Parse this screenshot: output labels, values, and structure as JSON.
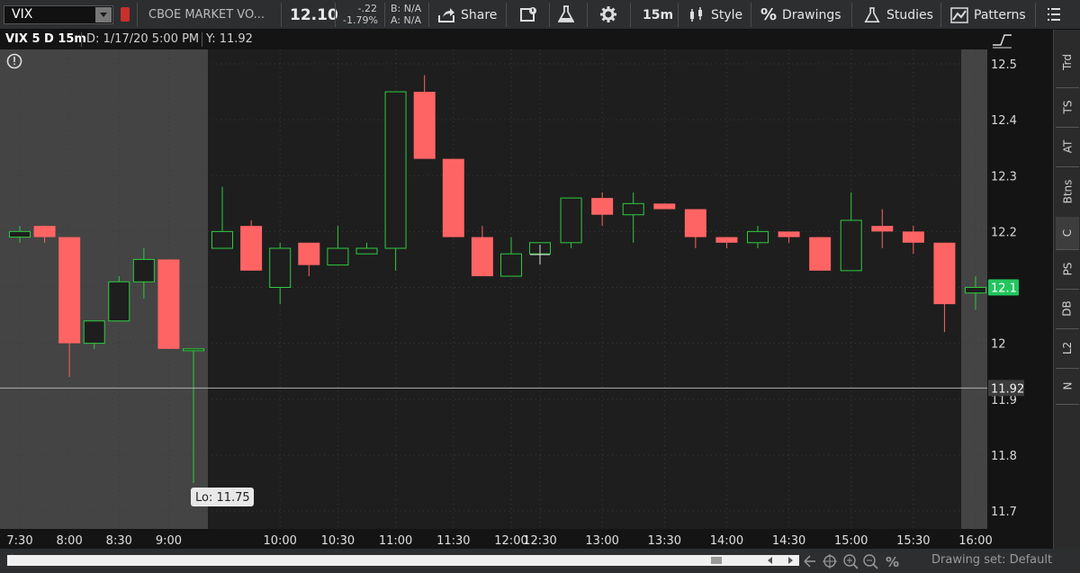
{
  "toolbar": {
    "symbol": "VIX",
    "description": "CBOE MARKET VO...",
    "last": "12.10",
    "net_change": "-.22",
    "pct_change": "-1.79%",
    "bid": "B: N/A",
    "ask": "A: N/A",
    "share": "Share",
    "timeframe": "15m",
    "style": "Style",
    "drawings": "Drawings",
    "studies": "Studies",
    "patterns": "Patterns"
  },
  "header": {
    "title": "VIX 5 D 15m",
    "date": "D: 1/17/20 5:00 PM",
    "y": "Y: 11.92"
  },
  "side_tabs": [
    "Trd",
    "TS",
    "AT",
    "Btns",
    "C",
    "PS",
    "DB",
    "L2",
    "N"
  ],
  "active_side_tab": "C",
  "drawing_set": "Drawing set: Default",
  "colors": {
    "up": "#2ecc40",
    "down": "#ff6464",
    "last_badge": "#22c55e",
    "background": "#1e1e1e",
    "extended_hours": "#444444"
  },
  "chart_data": {
    "type": "candlestick",
    "x_axis": {
      "labels": [
        "7:30",
        "8:00",
        "8:30",
        "9:00",
        "10:00",
        "10:30",
        "11:00",
        "11:30",
        "12:00",
        "12:30",
        "13:00",
        "13:30",
        "14:00",
        "14:30",
        "15:00",
        "15:30",
        "16:00"
      ]
    },
    "y_axis": {
      "ticks": [
        "12.5",
        "12.4",
        "12.3",
        "12.2",
        "12.1",
        "12",
        "11.9",
        "11.8",
        "11.7"
      ],
      "range": [
        11.67,
        12.52
      ]
    },
    "last_price_label": "12.1",
    "crosshair_label": "11.92",
    "crosshair_price": 11.92,
    "low_marker": {
      "label": "Lo: 11.75",
      "time": "9:15"
    },
    "candles": [
      {
        "t": "7:30",
        "o": 12.19,
        "h": 12.21,
        "l": 12.18,
        "c": 12.2
      },
      {
        "t": "7:45",
        "o": 12.21,
        "h": 12.21,
        "l": 12.18,
        "c": 12.19
      },
      {
        "t": "8:00",
        "o": 12.19,
        "h": 12.19,
        "l": 11.94,
        "c": 12.0
      },
      {
        "t": "8:15",
        "o": 12.0,
        "h": 12.04,
        "l": 11.99,
        "c": 12.04
      },
      {
        "t": "8:30",
        "o": 12.04,
        "h": 12.12,
        "l": 12.04,
        "c": 12.11
      },
      {
        "t": "8:45",
        "o": 12.11,
        "h": 12.17,
        "l": 12.08,
        "c": 12.15
      },
      {
        "t": "9:00",
        "o": 12.15,
        "h": 12.15,
        "l": 11.99,
        "c": 11.99
      },
      {
        "t": "9:15",
        "o": 11.99,
        "h": 11.99,
        "l": 11.75,
        "c": 11.99
      },
      {
        "t": "9:30",
        "o": 12.17,
        "h": 12.28,
        "l": 12.17,
        "c": 12.2
      },
      {
        "t": "9:45",
        "o": 12.21,
        "h": 12.22,
        "l": 12.13,
        "c": 12.13
      },
      {
        "t": "10:00",
        "o": 12.1,
        "h": 12.18,
        "l": 12.07,
        "c": 12.17
      },
      {
        "t": "10:15",
        "o": 12.18,
        "h": 12.18,
        "l": 12.12,
        "c": 12.14
      },
      {
        "t": "10:30",
        "o": 12.14,
        "h": 12.21,
        "l": 12.14,
        "c": 12.17
      },
      {
        "t": "10:45",
        "o": 12.16,
        "h": 12.18,
        "l": 12.16,
        "c": 12.17
      },
      {
        "t": "11:00",
        "o": 12.17,
        "h": 12.45,
        "l": 12.13,
        "c": 12.45
      },
      {
        "t": "11:15",
        "o": 12.45,
        "h": 12.48,
        "l": 12.33,
        "c": 12.33
      },
      {
        "t": "11:30",
        "o": 12.33,
        "h": 12.33,
        "l": 12.19,
        "c": 12.19
      },
      {
        "t": "11:45",
        "o": 12.19,
        "h": 12.21,
        "l": 12.12,
        "c": 12.12
      },
      {
        "t": "12:00",
        "o": 12.12,
        "h": 12.19,
        "l": 12.12,
        "c": 12.16
      },
      {
        "t": "12:30",
        "o": 12.16,
        "h": 12.18,
        "l": 12.16,
        "c": 12.18
      },
      {
        "t": "12:45",
        "o": 12.18,
        "h": 12.26,
        "l": 12.17,
        "c": 12.26
      },
      {
        "t": "13:00",
        "o": 12.26,
        "h": 12.27,
        "l": 12.21,
        "c": 12.23
      },
      {
        "t": "13:15",
        "o": 12.23,
        "h": 12.27,
        "l": 12.18,
        "c": 12.25
      },
      {
        "t": "13:30",
        "o": 12.25,
        "h": 12.25,
        "l": 12.24,
        "c": 12.24
      },
      {
        "t": "13:45",
        "o": 12.24,
        "h": 12.24,
        "l": 12.17,
        "c": 12.19
      },
      {
        "t": "14:00",
        "o": 12.19,
        "h": 12.19,
        "l": 12.17,
        "c": 12.18
      },
      {
        "t": "14:15",
        "o": 12.18,
        "h": 12.21,
        "l": 12.17,
        "c": 12.2
      },
      {
        "t": "14:30",
        "o": 12.2,
        "h": 12.2,
        "l": 12.18,
        "c": 12.19
      },
      {
        "t": "14:45",
        "o": 12.19,
        "h": 12.19,
        "l": 12.13,
        "c": 12.13
      },
      {
        "t": "15:00",
        "o": 12.13,
        "h": 12.27,
        "l": 12.13,
        "c": 12.22
      },
      {
        "t": "15:15",
        "o": 12.21,
        "h": 12.24,
        "l": 12.17,
        "c": 12.2
      },
      {
        "t": "15:30",
        "o": 12.2,
        "h": 12.21,
        "l": 12.16,
        "c": 12.18
      },
      {
        "t": "15:45",
        "o": 12.18,
        "h": 12.18,
        "l": 12.02,
        "c": 12.07
      },
      {
        "t": "16:00",
        "o": 12.09,
        "h": 12.12,
        "l": 12.06,
        "c": 12.1
      }
    ]
  }
}
